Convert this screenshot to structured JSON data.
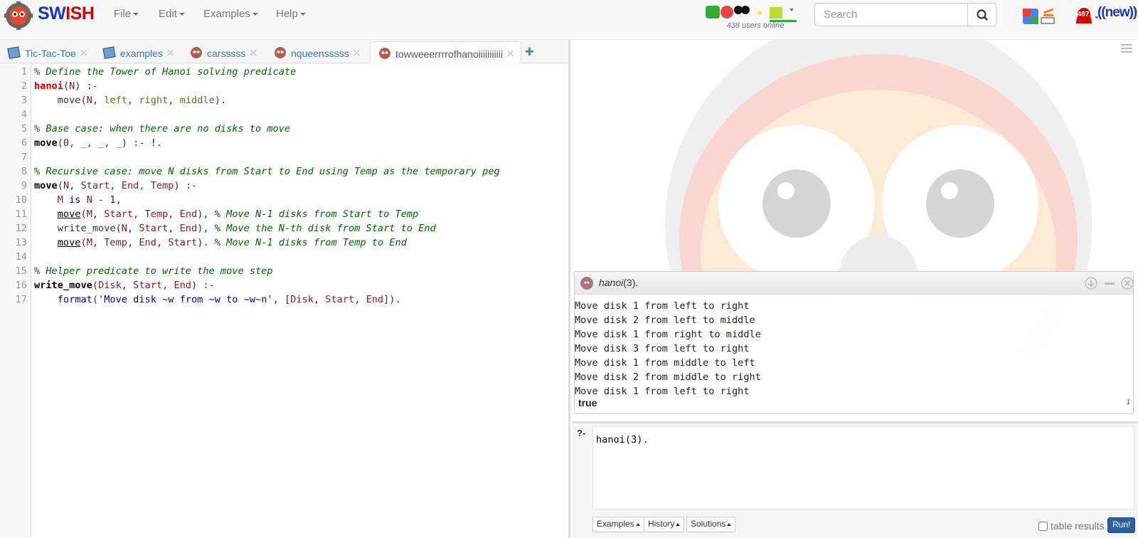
{
  "brand": {
    "part1": "SW",
    "part2": "ISH"
  },
  "menu": [
    {
      "label": "File"
    },
    {
      "label": "Edit"
    },
    {
      "label": "Examples"
    },
    {
      "label": "Help"
    }
  ],
  "users_online": "438 users online",
  "search": {
    "placeholder": "Search"
  },
  "notifications": {
    "count": "487"
  },
  "new_link": "((new))",
  "tabs": [
    {
      "label": "Tic-Tac-Toe",
      "icon": "notebook-icon"
    },
    {
      "label": "examples",
      "icon": "notebook-icon"
    },
    {
      "label": "carsssss",
      "icon": "swish-program-icon"
    },
    {
      "label": "nqueensssss",
      "icon": "swish-program-icon"
    },
    {
      "label": "towweeerrrrofhanoiiiiiiiiiii",
      "icon": "swish-program-icon"
    }
  ],
  "editor": {
    "line_numbers": [
      "1",
      "2",
      "3",
      "4",
      "5",
      "6",
      "7",
      "8",
      "9",
      "10",
      "11",
      "12",
      "13",
      "14",
      "15",
      "16",
      "17"
    ]
  },
  "runner": {
    "query_pred": "hanoi",
    "query_args": "(3).",
    "output": [
      "Move disk 1 from left to right",
      "Move disk 2 from left to middle",
      "Move disk 1 from right to middle",
      "Move disk 3 from left to right",
      "Move disk 1 from middle to left",
      "Move disk 2 from middle to right",
      "Move disk 1 from left to right"
    ],
    "answer": "true",
    "answer_count": "1"
  },
  "query": {
    "prompt": "?-",
    "text": "hanoi(3).",
    "buttons": {
      "examples": "Examples",
      "history": "History",
      "solutions": "Solutions"
    },
    "table_results_label": "table results",
    "run_label": "Run!"
  }
}
